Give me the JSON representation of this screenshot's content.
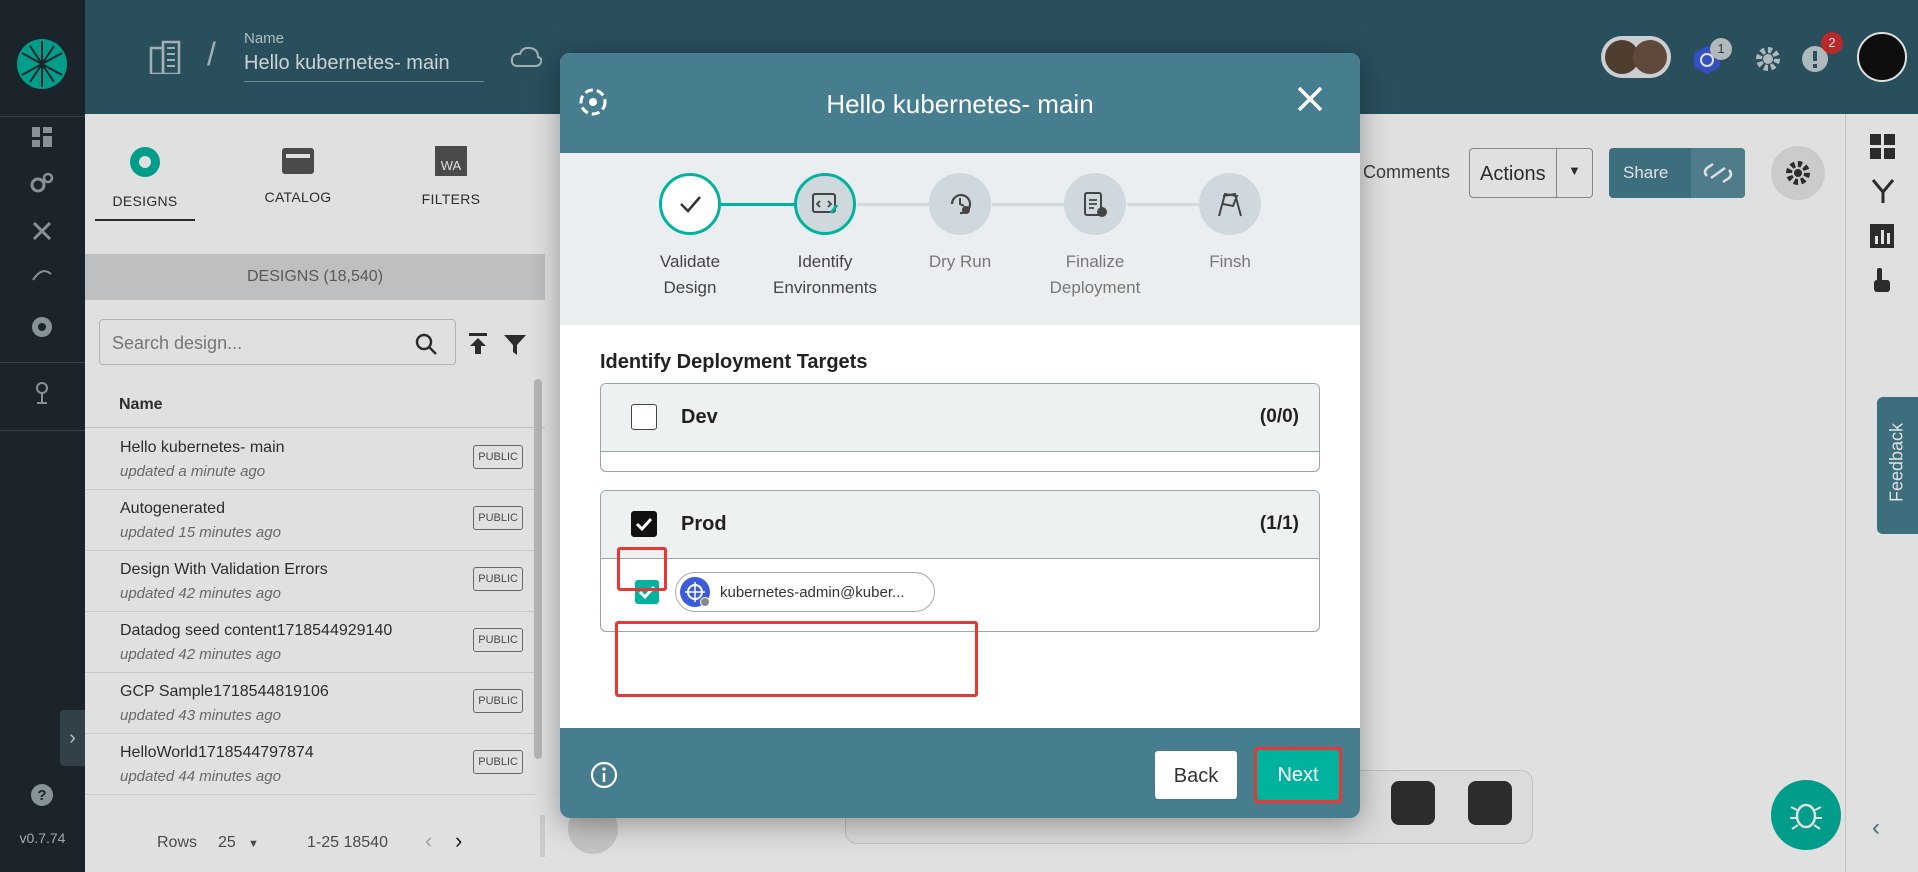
{
  "app": {
    "version": "v0.7.74"
  },
  "header": {
    "name_label": "Name",
    "design_name": "Hello kubernetes- main",
    "notifications_count": "1",
    "alerts_count": "2"
  },
  "canvas_toolbar": {
    "comments": "Comments",
    "actions": "Actions",
    "share": "Share"
  },
  "feedback": "Feedback",
  "panel": {
    "tabs": [
      {
        "label": "DESIGNS"
      },
      {
        "label": "CATALOG"
      },
      {
        "label": "FILTERS"
      }
    ],
    "count_label": "DESIGNS (18,540)",
    "search_placeholder": "Search design...",
    "column_name": "Name",
    "rows": [
      {
        "title": "Hello kubernetes- main",
        "subtitle": "updated a minute ago",
        "badge": "PUBLIC"
      },
      {
        "title": "Autogenerated",
        "subtitle": "updated 15 minutes ago",
        "badge": "PUBLIC"
      },
      {
        "title": "Design With Validation Errors",
        "subtitle": "updated 42 minutes ago",
        "badge": "PUBLIC"
      },
      {
        "title": "Datadog seed content1718544929140",
        "subtitle": "updated 42 minutes ago",
        "badge": "PUBLIC"
      },
      {
        "title": "GCP Sample1718544819106",
        "subtitle": "updated 43 minutes ago",
        "badge": "PUBLIC"
      },
      {
        "title": "HelloWorld1718544797874",
        "subtitle": "updated 44 minutes ago",
        "badge": "PUBLIC"
      }
    ],
    "pager": {
      "rows_label": "Rows",
      "rows_value": "25",
      "range": "1-25 18540"
    }
  },
  "modal": {
    "title": "Hello kubernetes- main",
    "steps": [
      {
        "label_line1": "Validate",
        "label_line2": "Design",
        "state": "done"
      },
      {
        "label_line1": "Identify",
        "label_line2": "Environments",
        "state": "active"
      },
      {
        "label_line1": "Dry Run",
        "label_line2": "",
        "state": "pending"
      },
      {
        "label_line1": "Finalize",
        "label_line2": "Deployment",
        "state": "pending"
      },
      {
        "label_line1": "Finsh",
        "label_line2": "",
        "state": "pending"
      }
    ],
    "section_title": "Identify Deployment Targets",
    "environments": [
      {
        "name": "Dev",
        "count": "(0/0)",
        "checked": false
      },
      {
        "name": "Prod",
        "count": "(1/1)",
        "checked": true,
        "connection": "kubernetes-admin@kuber..."
      }
    ],
    "back_label": "Back",
    "next_label": "Next"
  },
  "colors": {
    "teal": "#00b39f",
    "header": "#2f5a6a",
    "modal_header": "#467e90",
    "highlight": "#e53935"
  }
}
